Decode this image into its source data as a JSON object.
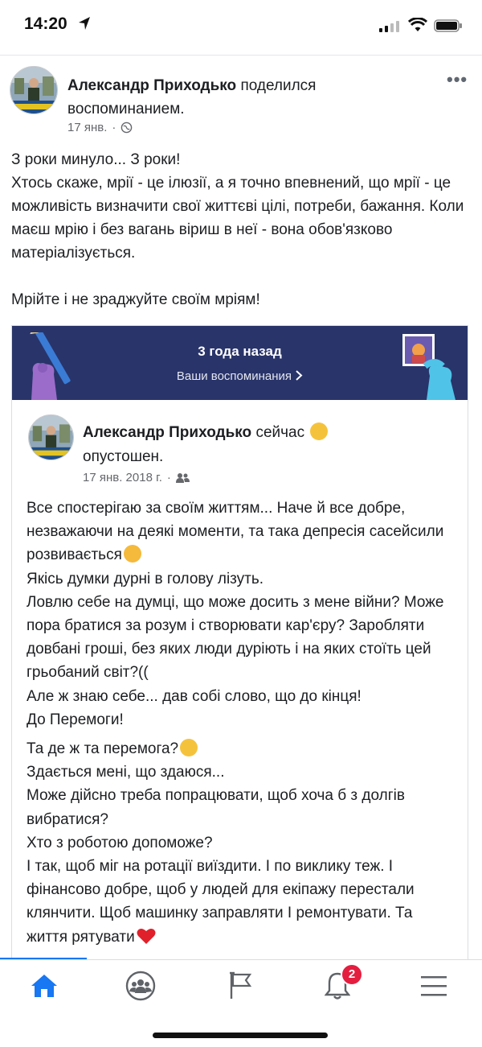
{
  "status_bar": {
    "time": "14:20"
  },
  "post": {
    "author": "Александр Приходько",
    "action": "поделился воспоминанием.",
    "date": "17 янв.",
    "more": "•••",
    "text": [
      "З роки минуло... З роки!",
      "Хтось скаже,   мрії - це ілюзії, а я точно впевнений, що мрії - це можливість визначити свої життєві цілі, потреби, бажання. Коли маєш мрію і без вагань віриш в неї - вона обов'язково матеріалізується.",
      "Мрійте і не зраджуйте своїм мріям!"
    ]
  },
  "memory": {
    "title": "3 года назад",
    "link": "Ваши воспоминания",
    "author": "Александр Приходько",
    "status_word": "сейчас",
    "status_feeling": "опустошен.",
    "date": "17 янв. 2018 г.",
    "lines": [
      "Все спостерігаю за своїм життям... Наче й все добре, незважаючи на деякі моменти, та така депресія сасейсили розвивається",
      " Якісь думки дурні в голову лізуть.",
      "Ловлю себе на думці, що може досить з мене війни? Може пора братися за розум і створювати кар'єру? Заробляти довбані гроші, без яких люди дуріють і на яких стоїть цей грьобаний світ?((",
      " Але ж знаю себе... дав собі слово, що до кінця!",
      "До Перемоги!",
      "Та де ж та перемога?",
      "Здається мені, що здаюся...",
      "Може дійсно треба попрацювати,  щоб хоча б з долгів вибратися?",
      "Хто з роботою допоможе?",
      "І так, щоб міг на ротації виїздити. І по виклику теж. І фінансово добре, щоб у людей для екіпажу перестали клянчити. Щоб машинку заправляти І ремонтувати. Та життя рятувати"
    ]
  },
  "nav": {
    "items": [
      "home-icon",
      "groups-icon",
      "pages-flag-icon",
      "notifications-bell-icon",
      "menu-icon"
    ],
    "notifications_badge": "2",
    "accent": "#1877f2"
  }
}
